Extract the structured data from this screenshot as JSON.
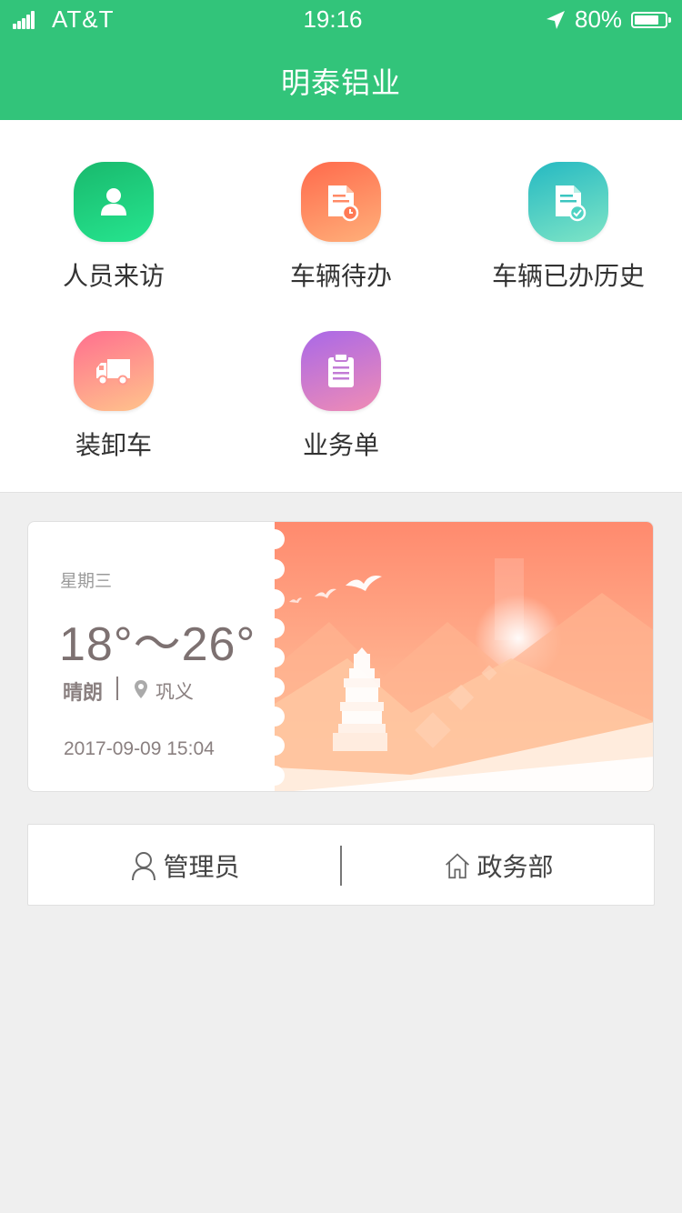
{
  "status_bar": {
    "carrier": "AT&T",
    "time": "19:16",
    "battery_percent": "80%",
    "battery_level": 0.8
  },
  "nav": {
    "title": "明泰铝业"
  },
  "grid": {
    "items": [
      {
        "label": "人员来访",
        "icon": "person-icon",
        "gradient": [
          "#19b96d",
          "#26e58f"
        ]
      },
      {
        "label": "车辆待办",
        "icon": "document-clock-icon",
        "gradient": [
          "#ff6a4c",
          "#ffb07a"
        ]
      },
      {
        "label": "车辆已办历史",
        "icon": "document-check-icon",
        "gradient": [
          "#25b9c2",
          "#7fe5c6"
        ]
      },
      {
        "label": "装卸车",
        "icon": "truck-icon",
        "gradient": [
          "#ff6f8e",
          "#ffc48c"
        ]
      },
      {
        "label": "业务单",
        "icon": "clipboard-icon",
        "gradient": [
          "#a968e8",
          "#f08cb4"
        ]
      }
    ]
  },
  "weather": {
    "weekday": "星期三",
    "temperature": "18°～26°",
    "condition": "晴朗",
    "city": "巩义",
    "datetime": "2017-09-09 15:04",
    "accent_gradient": [
      "#ff8a6e",
      "#ffd0a8"
    ]
  },
  "info_bar": {
    "user": "管理员",
    "department": "政务部"
  },
  "colors": {
    "brand": "#32c47a",
    "background": "#efefef"
  }
}
